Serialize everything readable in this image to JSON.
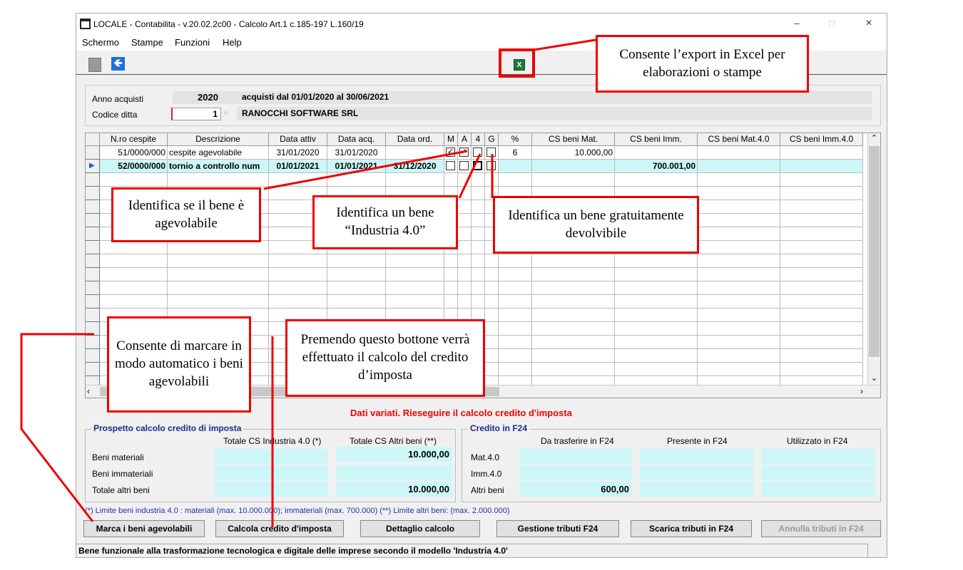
{
  "window": {
    "title": "LOCALE - Contabilita - v.20.02.2c00 - Calcolo Art.1 c.185-197 L.160/19",
    "minimize": "–",
    "maximize": "□",
    "close": "×"
  },
  "menu": [
    "Schermo",
    "Stampe",
    "Funzioni",
    "Help"
  ],
  "toolbar": {
    "excel_icon": "X",
    "back_icon": "🡸"
  },
  "header": {
    "anno_label": "Anno acquisti",
    "anno_value": "2020",
    "acquisti_text": "acquisti dal 01/01/2020 al 30/06/2021",
    "codice_label": "Codice ditta",
    "codice_value": "1",
    "company": "RANOCCHI SOFTWARE SRL"
  },
  "grid": {
    "columns": [
      "N.ro cespite",
      "Descrizione",
      "Data attiv",
      "Data acq.",
      "Data ord.",
      "M",
      "A",
      "4",
      "G",
      "%",
      "CS beni Mat.",
      "CS beni Imm.",
      "CS beni Mat.4.0",
      "CS beni Imm.4.0"
    ],
    "rows": [
      {
        "cespite": "51/0000/000",
        "descrizione": "cespite agevolabile",
        "data_attiv": "31/01/2020",
        "data_acq": "31/01/2020",
        "data_ord": "",
        "m": true,
        "a": true,
        "i4": false,
        "g": false,
        "perc": "6",
        "cs_mat": "10.000,00",
        "cs_imm": "",
        "selected": false
      },
      {
        "cespite": "52/0000/000",
        "descrizione": "tornio a controllo num",
        "data_attiv": "01/01/2021",
        "data_acq": "01/01/2021",
        "data_ord": "31/12/2020",
        "m": false,
        "a": false,
        "i4": false,
        "g": false,
        "perc": "",
        "cs_mat": "",
        "cs_imm": "700.001,00",
        "selected": true
      }
    ]
  },
  "warning": "Dati variati. Rieseguire il calcolo credito d'imposta",
  "prospetto": {
    "title": "Prospetto calcolo credito di imposta",
    "col1": "Totale CS Industria 4.0 (*)",
    "col2": "Totale CS Altri beni (**)",
    "rows": [
      {
        "label": "Beni materiali",
        "v1": "",
        "v2": "10.000,00"
      },
      {
        "label": "Beni immateriali",
        "v1": "",
        "v2": ""
      },
      {
        "label": "Totale altri beni",
        "v1": "",
        "v2": "10.000,00"
      }
    ]
  },
  "credito": {
    "title": "Credito in F24",
    "col1": "Da trasferire in F24",
    "col2": "Presente in F24",
    "col3": "Utilizzato in F24",
    "rows": [
      {
        "label": "Mat.4.0",
        "v1": "",
        "v2": "",
        "v3": ""
      },
      {
        "label": "Imm.4.0",
        "v1": "",
        "v2": "",
        "v3": ""
      },
      {
        "label": "Altri beni",
        "v1": "600,00",
        "v2": "",
        "v3": ""
      }
    ]
  },
  "note": "(*) Limite beni industria 4.0 : materiali (max. 10.000.000); immateriali (max. 700.000) (**) Limite altri beni: (max. 2.000.000)",
  "buttons": {
    "marca": "Marca i beni agevolabili",
    "calcola": "Calcola credito d'imposta",
    "dettaglio": "Dettaglio calcolo",
    "gestione": "Gestione tributi F24",
    "scarica": "Scarica tributi in F24",
    "annulla": "Annulla tributi in F24"
  },
  "status": "Bene funzionale alla trasformazione tecnologica e digitale delle imprese secondo il  modello 'Industria 4.0'",
  "callouts": {
    "excel": "Consente l’export in Excel per elaborazioni o stampe",
    "agevolabile": "Identifica se il bene è agevolabile",
    "industria": "Identifica un bene “Industria 4.0”",
    "devolvibile": "Identifica un bene gratuitamente devolvibile",
    "marcare": "Consente di marcare in modo automatico i beni agevolabili",
    "premendo": "Premendo questo bottone verrà effettuato il calcolo del credito d’imposta"
  },
  "colors": {
    "accent_red": "#e00000",
    "cyan_field": "#cdf6f8",
    "selected_row": "#cdf6f8",
    "group_title": "#1a2b88"
  }
}
